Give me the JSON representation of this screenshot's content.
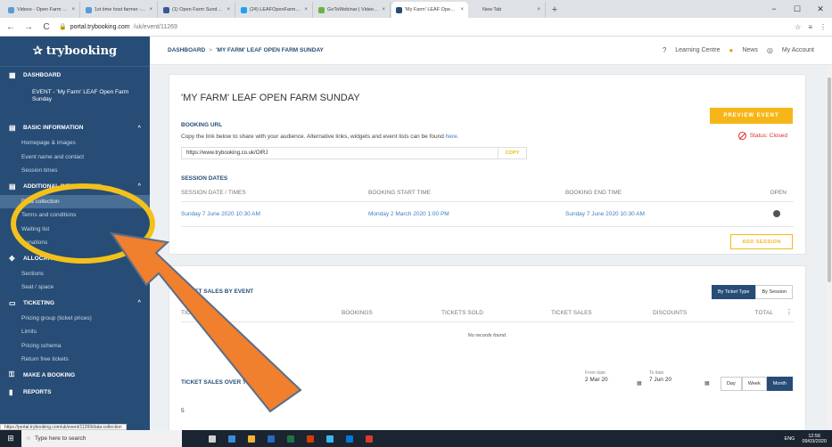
{
  "browser": {
    "tabs": [
      {
        "title": "Videos - Open Farm Sunday",
        "color": "#5a9bd4"
      },
      {
        "title": "1st time host farmer - Open Farm",
        "color": "#5a9bd4"
      },
      {
        "title": "(1) Open Farm Sunday Host Farm",
        "color": "#3b5998"
      },
      {
        "title": "(24) LEAFOpenFarmSunday (@O...",
        "color": "#1da1f2"
      },
      {
        "title": "GoToWebinar | Video Library",
        "color": "#67b346"
      },
      {
        "title": "'My Farm' LEAF Open Farm Sund",
        "color": "#274d76",
        "active": true
      },
      {
        "title": "New Tab",
        "color": "#dee1e6"
      }
    ],
    "tab_close": "×",
    "new_tab": "+",
    "window_controls": [
      "−",
      "☐",
      "✕"
    ],
    "nav": {
      "back": "←",
      "forward": "→",
      "reload": "C"
    },
    "url_host": "portal.trybooking.com",
    "url_path": "/uk/event/11269",
    "addr_icons": [
      "☆",
      "≡",
      "⋮"
    ]
  },
  "sidebar": {
    "logo": "trybooking",
    "logo_star": "✰",
    "dashboard": "DASHBOARD",
    "event_label": "EVENT - 'My Farm' LEAF Open Farm Sunday",
    "groups": [
      {
        "title": "BASIC INFORMATION",
        "icon": "▤",
        "items": [
          "Homepage & images",
          "Event name and contact",
          "Session times"
        ]
      },
      {
        "title": "ADDITIONAL INFORMATION",
        "icon": "▤",
        "items": [
          "Data collection",
          "Terms and conditions",
          "Waiting list",
          "Donations"
        ],
        "active_item": 0
      },
      {
        "title": "ALLOCATION",
        "icon": "✥",
        "items": [
          "Sections",
          "Seat / space"
        ]
      },
      {
        "title": "TICKETING",
        "icon": "▭",
        "items": [
          "Pricing group (ticket prices)",
          "Limits",
          "Pricing schema",
          "Return free tickets"
        ]
      }
    ],
    "make_booking": "MAKE A BOOKING",
    "reports": "REPORTS",
    "chevron": "^"
  },
  "topnav": {
    "breadcrumb_home": "DASHBOARD",
    "breadcrumb_sep": ">",
    "breadcrumb_current": "'MY FARM' LEAF OPEN FARM SUNDAY",
    "learning": "Learning Centre",
    "news": "News",
    "account": "My Account"
  },
  "event": {
    "title": "'MY FARM' LEAF OPEN FARM SUNDAY",
    "preview_button": "PREVIEW EVENT",
    "status": "Status: Closed",
    "booking_url_label": "BOOKING URL",
    "booking_desc": "Copy the link below to share with your audience. Alternative links, widgets and event lists can be found",
    "booking_desc_link": "here.",
    "booking_url": "https://www.trybooking.co.uk/OIRJ",
    "copy_button": "COPY",
    "session_dates_label": "SESSION DATES",
    "session_headers": [
      "SESSION DATE / TIMES",
      "BOOKING START TIME",
      "BOOKING END TIME",
      "OPEN"
    ],
    "session_row": [
      "Sunday 7 June 2020 10:30 AM",
      "Monday 2 March 2020 1:00 PM",
      "Sunday 7 June 2020 10:30 AM"
    ],
    "add_session": "ADD SESSION"
  },
  "sales": {
    "title": "TICKET SALES BY EVENT",
    "toggle": [
      "By Ticket Type",
      "By Session"
    ],
    "headers": [
      "TICKET",
      "BOOKINGS",
      "TICKETS SOLD",
      "TICKET SALES",
      "DISCOUNTS",
      "TOTAL"
    ],
    "more": "⋮",
    "no_records": "No records found.",
    "over_time_title": "TICKET SALES OVER TIME",
    "from_label": "From date",
    "from_value": "2 Mar 20",
    "to_label": "To date",
    "to_value": "7 Jun 20",
    "cal_icon": "▦",
    "range": [
      "Day",
      "Week",
      "Month"
    ],
    "axis_start": "5"
  },
  "status_url": "https://portal.trybooking.com/uk/event/11269/data-collection",
  "taskbar": {
    "search_placeholder": "Type here to search",
    "win": "⊞",
    "search_icon": "○",
    "icon_colors": [
      "#d0d0d0",
      "#3a8ed8",
      "#f2b233",
      "#2a68c2",
      "#217346",
      "#d83b01",
      "#3ab7f0",
      "#0078d4",
      "#d73b2e"
    ],
    "lang": "ENG",
    "time": "12:56",
    "date": "09/03/2020"
  }
}
